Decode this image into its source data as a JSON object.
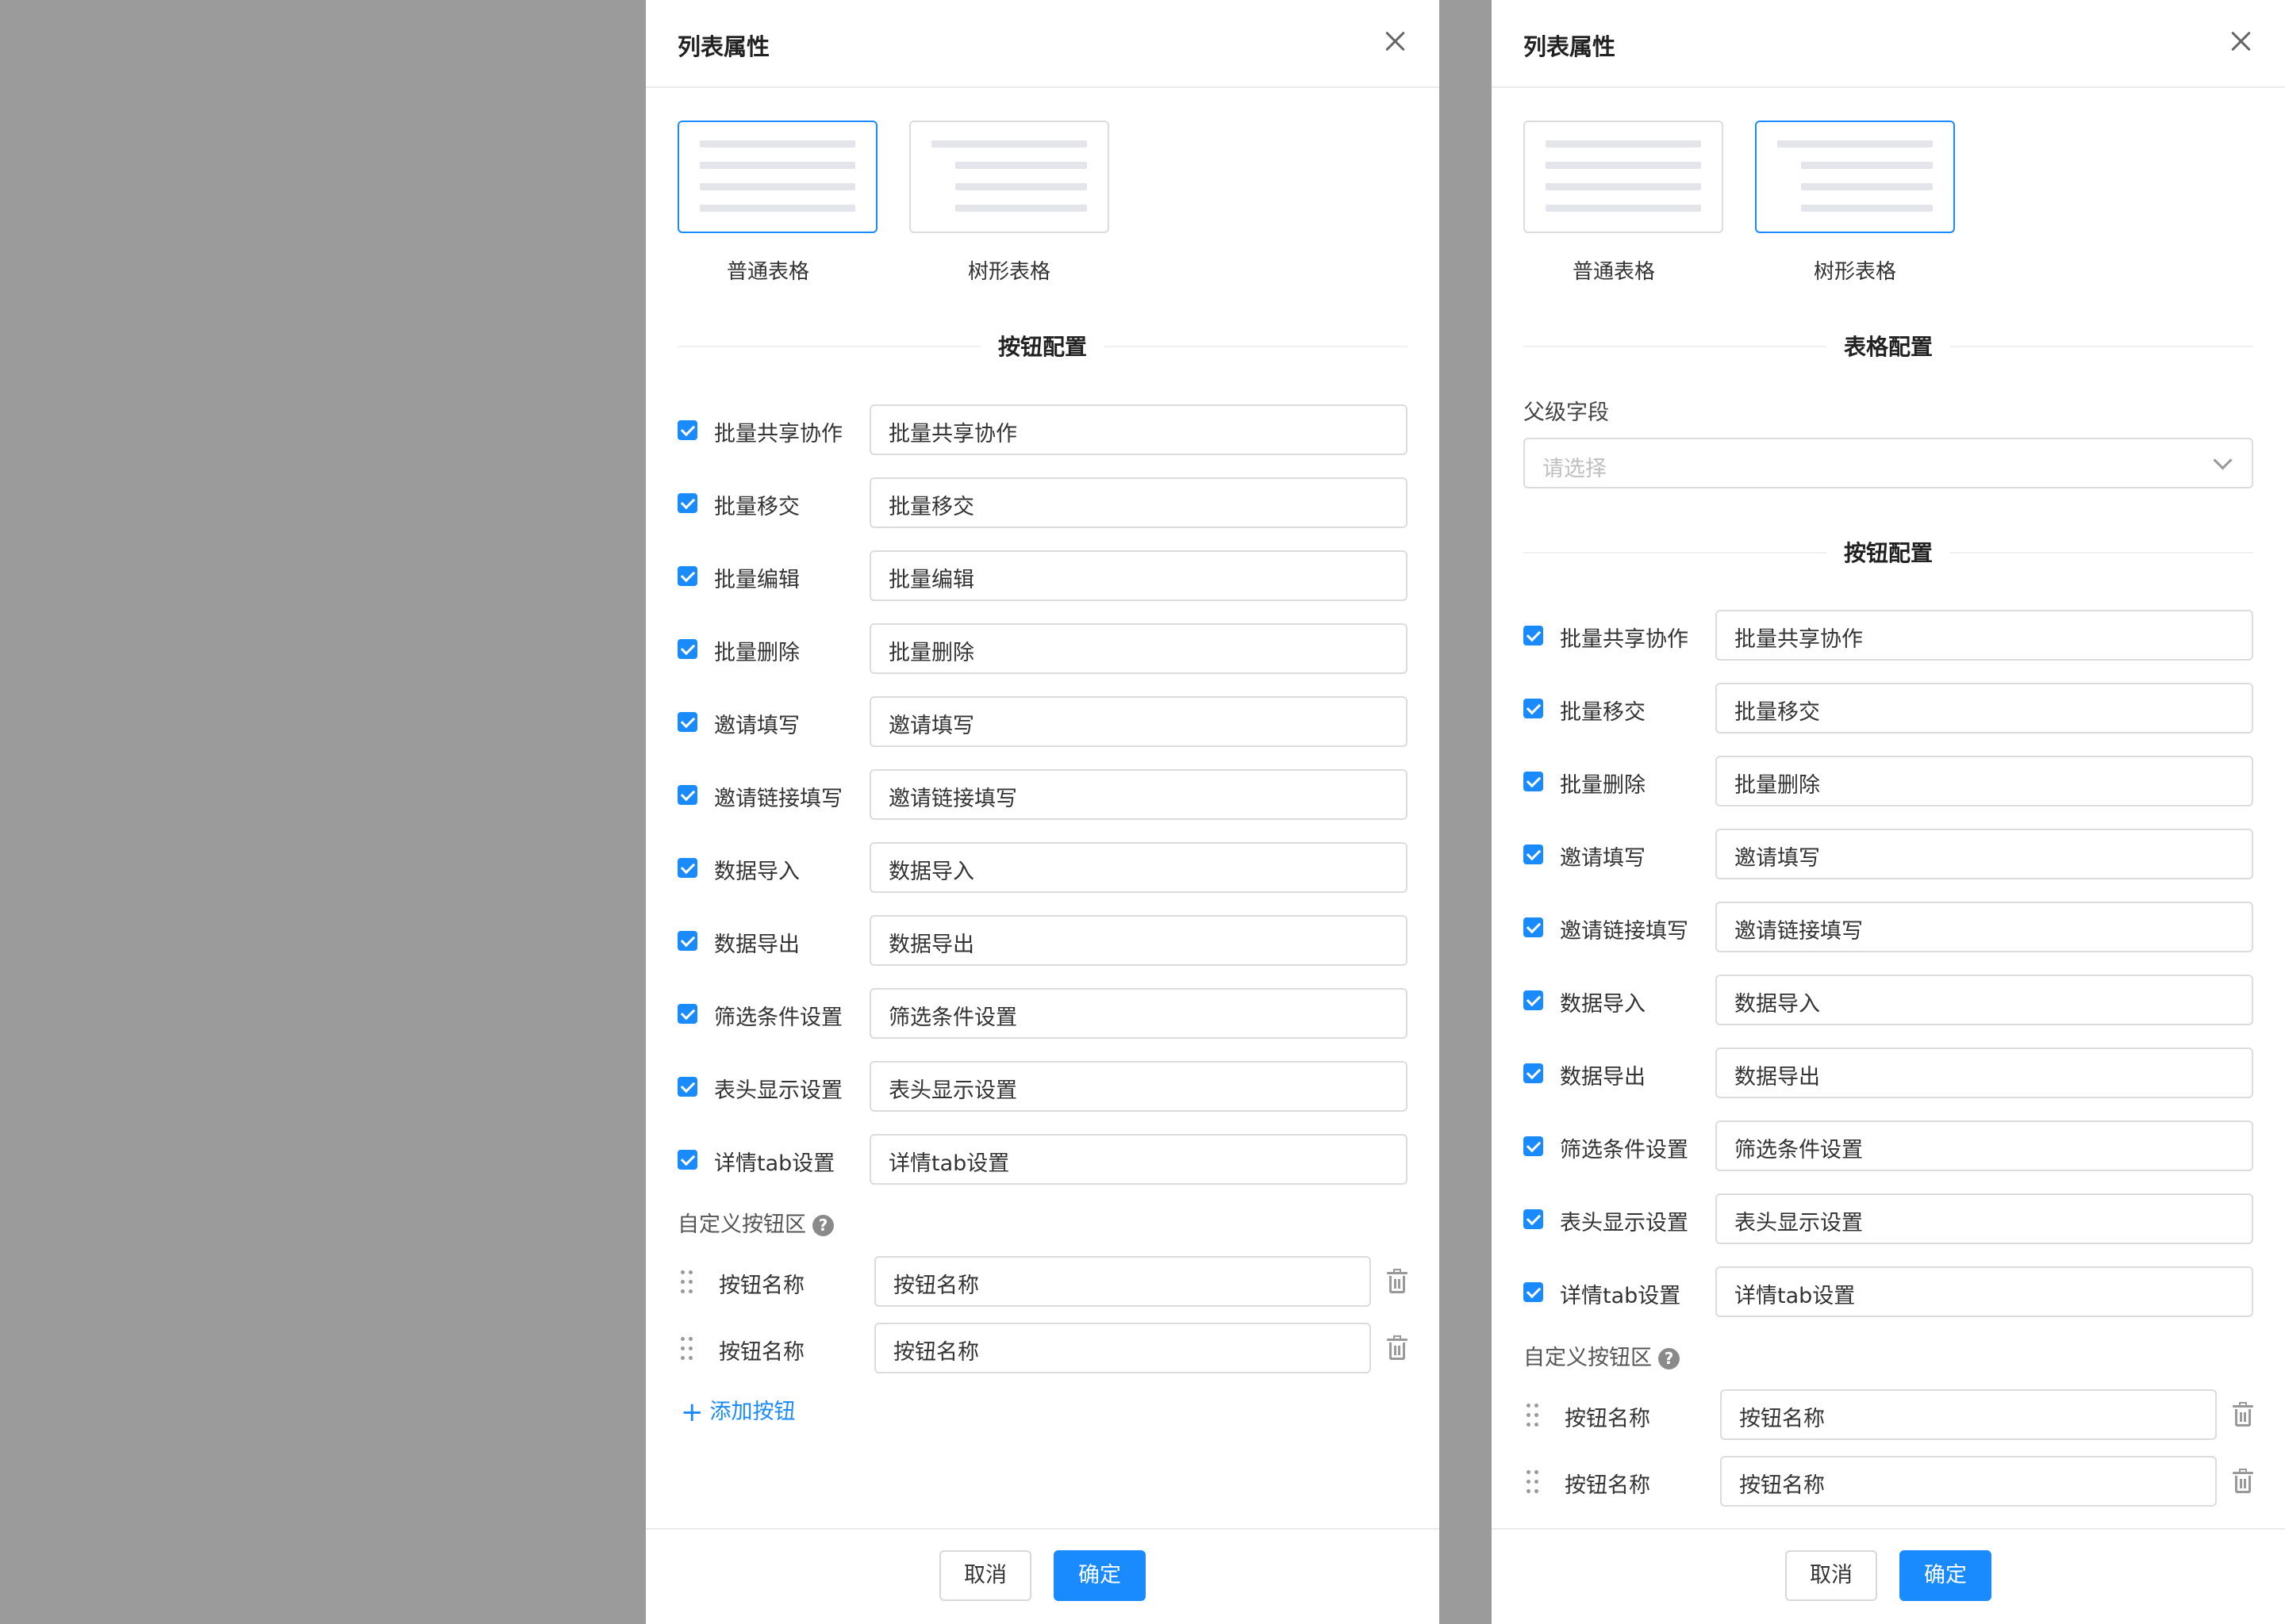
{
  "panels": [
    {
      "title": "列表属性",
      "table_types": [
        {
          "label": "普通表格",
          "selected": true
        },
        {
          "label": "树形表格",
          "selected": false
        }
      ],
      "section_button": "按钮配置",
      "buttons": [
        {
          "label": "批量共享协作",
          "value": "批量共享协作",
          "checked": true
        },
        {
          "label": "批量移交",
          "value": "批量移交",
          "checked": true
        },
        {
          "label": "批量编辑",
          "value": "批量编辑",
          "checked": true
        },
        {
          "label": "批量删除",
          "value": "批量删除",
          "checked": true
        },
        {
          "label": "邀请填写",
          "value": "邀请填写",
          "checked": true
        },
        {
          "label": "邀请链接填写",
          "value": "邀请链接填写",
          "checked": true
        },
        {
          "label": "数据导入",
          "value": "数据导入",
          "checked": true
        },
        {
          "label": "数据导出",
          "value": "数据导出",
          "checked": true
        },
        {
          "label": "筛选条件设置",
          "value": "筛选条件设置",
          "checked": true
        },
        {
          "label": "表头显示设置",
          "value": "表头显示设置",
          "checked": true
        },
        {
          "label": "详情tab设置",
          "value": "详情tab设置",
          "checked": true
        }
      ],
      "custom_area_label": "自定义按钮区",
      "help_icon_text": "?",
      "custom_buttons": [
        {
          "label": "按钮名称",
          "value": "按钮名称"
        },
        {
          "label": "按钮名称",
          "value": "按钮名称"
        }
      ],
      "add_button_label": "添加按钮",
      "add_icon_text": "+",
      "footer": {
        "cancel": "取消",
        "ok": "确定"
      }
    },
    {
      "title": "列表属性",
      "table_types": [
        {
          "label": "普通表格",
          "selected": false
        },
        {
          "label": "树形表格",
          "selected": true
        }
      ],
      "section_table": "表格配置",
      "parent_field_label": "父级字段",
      "parent_field_placeholder": "请选择",
      "section_button": "按钮配置",
      "buttons": [
        {
          "label": "批量共享协作",
          "value": "批量共享协作",
          "checked": true
        },
        {
          "label": "批量移交",
          "value": "批量移交",
          "checked": true
        },
        {
          "label": "批量删除",
          "value": "批量删除",
          "checked": true
        },
        {
          "label": "邀请填写",
          "value": "邀请填写",
          "checked": true
        },
        {
          "label": "邀请链接填写",
          "value": "邀请链接填写",
          "checked": true
        },
        {
          "label": "数据导入",
          "value": "数据导入",
          "checked": true
        },
        {
          "label": "数据导出",
          "value": "数据导出",
          "checked": true
        },
        {
          "label": "筛选条件设置",
          "value": "筛选条件设置",
          "checked": true
        },
        {
          "label": "表头显示设置",
          "value": "表头显示设置",
          "checked": true
        },
        {
          "label": "详情tab设置",
          "value": "详情tab设置",
          "checked": true
        }
      ],
      "custom_area_label": "自定义按钮区",
      "help_icon_text": "?",
      "custom_buttons": [
        {
          "label": "按钮名称",
          "value": "按钮名称"
        },
        {
          "label": "按钮名称",
          "value": "按钮名称"
        }
      ],
      "footer": {
        "cancel": "取消",
        "ok": "确定"
      }
    }
  ],
  "colors": {
    "accent": "#1a8bff",
    "backdrop": "#9b9b9b",
    "border": "#dcdcdc"
  }
}
